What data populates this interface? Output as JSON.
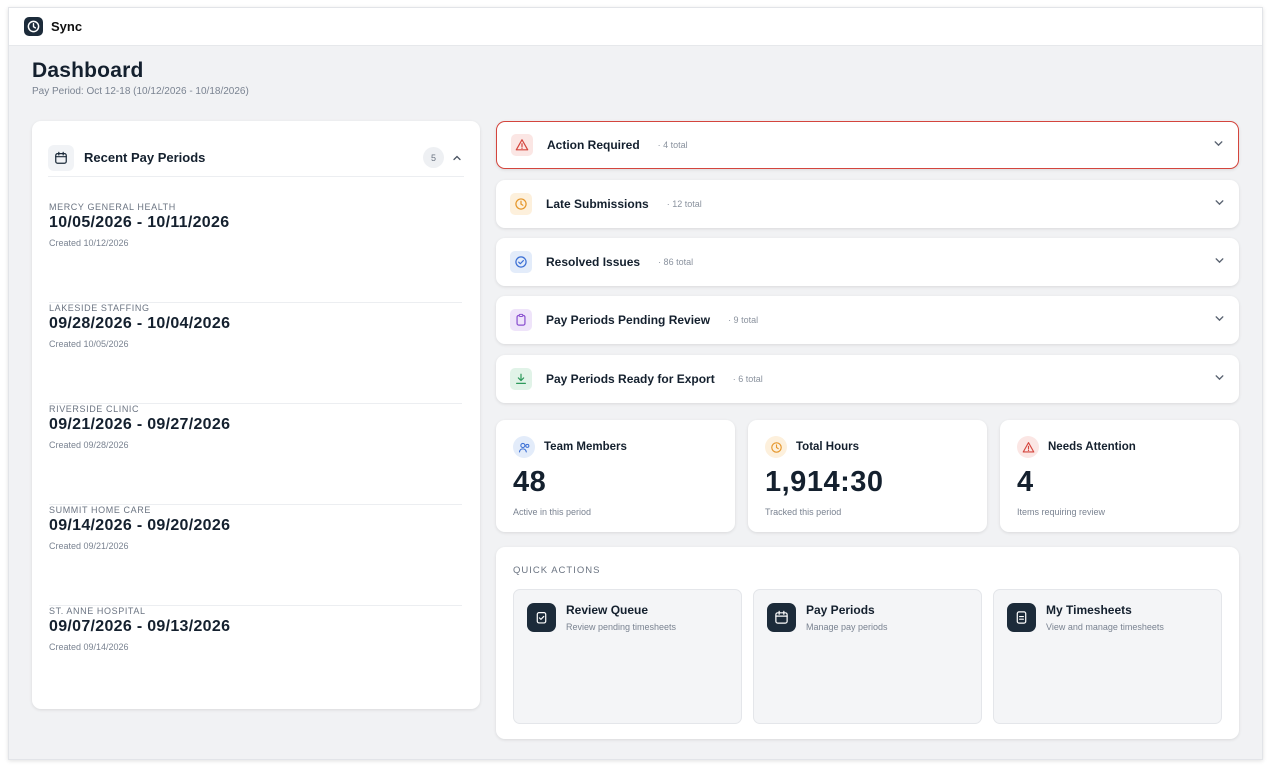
{
  "app": {
    "name": "Sync"
  },
  "page": {
    "title": "Dashboard",
    "subtitle": "Pay Period: Oct 12-18 (10/12/2026 - 10/18/2026)"
  },
  "recent": {
    "title": "Recent Pay Periods",
    "count": "5",
    "items": [
      {
        "org": "MERCY GENERAL HEALTH",
        "range": "10/05/2026 - 10/11/2026",
        "created": "Created 10/12/2026"
      },
      {
        "org": "LAKESIDE STAFFING",
        "range": "09/28/2026 - 10/04/2026",
        "created": "Created 10/05/2026"
      },
      {
        "org": "RIVERSIDE CLINIC",
        "range": "09/21/2026 - 09/27/2026",
        "created": "Created 09/28/2026"
      },
      {
        "org": "SUMMIT HOME CARE",
        "range": "09/14/2026 - 09/20/2026",
        "created": "Created 09/21/2026"
      },
      {
        "org": "ST. ANNE HOSPITAL",
        "range": "09/07/2026 - 09/13/2026",
        "created": "Created 09/14/2026"
      }
    ]
  },
  "sections": [
    {
      "title": "Action Required",
      "count": "· 4 total",
      "icon": "warning-icon",
      "color": "#d4453d"
    },
    {
      "title": "Late Submissions",
      "count": "· 12 total",
      "icon": "clock-icon",
      "color": "#e5962a"
    },
    {
      "title": "Resolved Issues",
      "count": "· 86 total",
      "icon": "check-circle-icon",
      "color": "#3b6fd4"
    },
    {
      "title": "Pay Periods Pending Review",
      "count": "· 9 total",
      "icon": "clipboard-icon",
      "color": "#8a4fcf"
    },
    {
      "title": "Pay Periods Ready for Export",
      "count": "· 6 total",
      "icon": "download-icon",
      "color": "#2e9a5c"
    }
  ],
  "stats": [
    {
      "label": "Team Members",
      "value": "48",
      "desc": "Active in this period",
      "icon": "users-icon"
    },
    {
      "label": "Total Hours",
      "value": "1,914:30",
      "desc": "Tracked this period",
      "icon": "clock-icon"
    },
    {
      "label": "Needs Attention",
      "value": "4",
      "desc": "Items requiring review",
      "icon": "warning-icon"
    }
  ],
  "quick_actions": {
    "title": "QUICK ACTIONS",
    "items": [
      {
        "label": "Review Queue",
        "desc": "Review pending timesheets",
        "icon": "clipboard-check-icon"
      },
      {
        "label": "Pay Periods",
        "desc": "Manage pay periods",
        "icon": "calendar-icon"
      },
      {
        "label": "My Timesheets",
        "desc": "View and manage timesheets",
        "icon": "document-icon"
      }
    ]
  }
}
